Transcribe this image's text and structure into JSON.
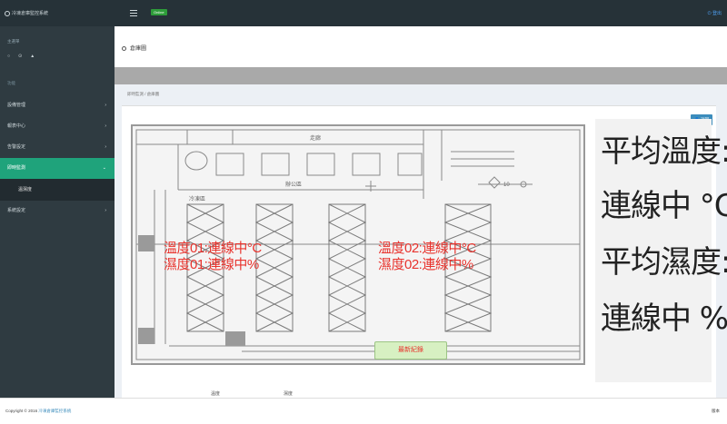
{
  "header": {
    "brand": "冷凍倉庫監控系統",
    "badge": "Online",
    "user_label": "登出"
  },
  "sidebar": {
    "heading": "主選單",
    "icons": [
      "○",
      "⊙",
      "▲"
    ],
    "sub_heading": "功能",
    "items": [
      {
        "label": "設備管理",
        "active": false
      },
      {
        "label": "報表中心",
        "active": false
      },
      {
        "label": "告警設定",
        "active": false
      },
      {
        "label": "即時監測",
        "active": true
      },
      {
        "label": "系統設定",
        "active": false
      }
    ],
    "active_sub": "溫濕度"
  },
  "page": {
    "title": "倉庫圖",
    "breadcrumb": "即時監測 / 倉庫圖",
    "back_button": "返回"
  },
  "plan": {
    "room_label": "走廊",
    "room_label_2": "辦公區",
    "room_label_3": "冷凍區",
    "door_label": "10",
    "sensor1_temp": "溫度01:連線中°C",
    "sensor1_hum": "濕度01:連線中%",
    "sensor2_temp": "溫度02:連線中°C",
    "sensor2_hum": "濕度02:連線中%",
    "green_button": "最新紀錄"
  },
  "summary": {
    "avg_temp_label": "平均溫度:",
    "avg_temp_value": "連線中 °C",
    "avg_hum_label": "平均濕度:",
    "avg_hum_value": "連線中 %"
  },
  "legend": {
    "temp": "溫度",
    "hum": "濕度"
  },
  "footer": {
    "copyright": "Copyright © 2016",
    "link": "冷凍倉庫監控系統",
    "version": "版本"
  }
}
